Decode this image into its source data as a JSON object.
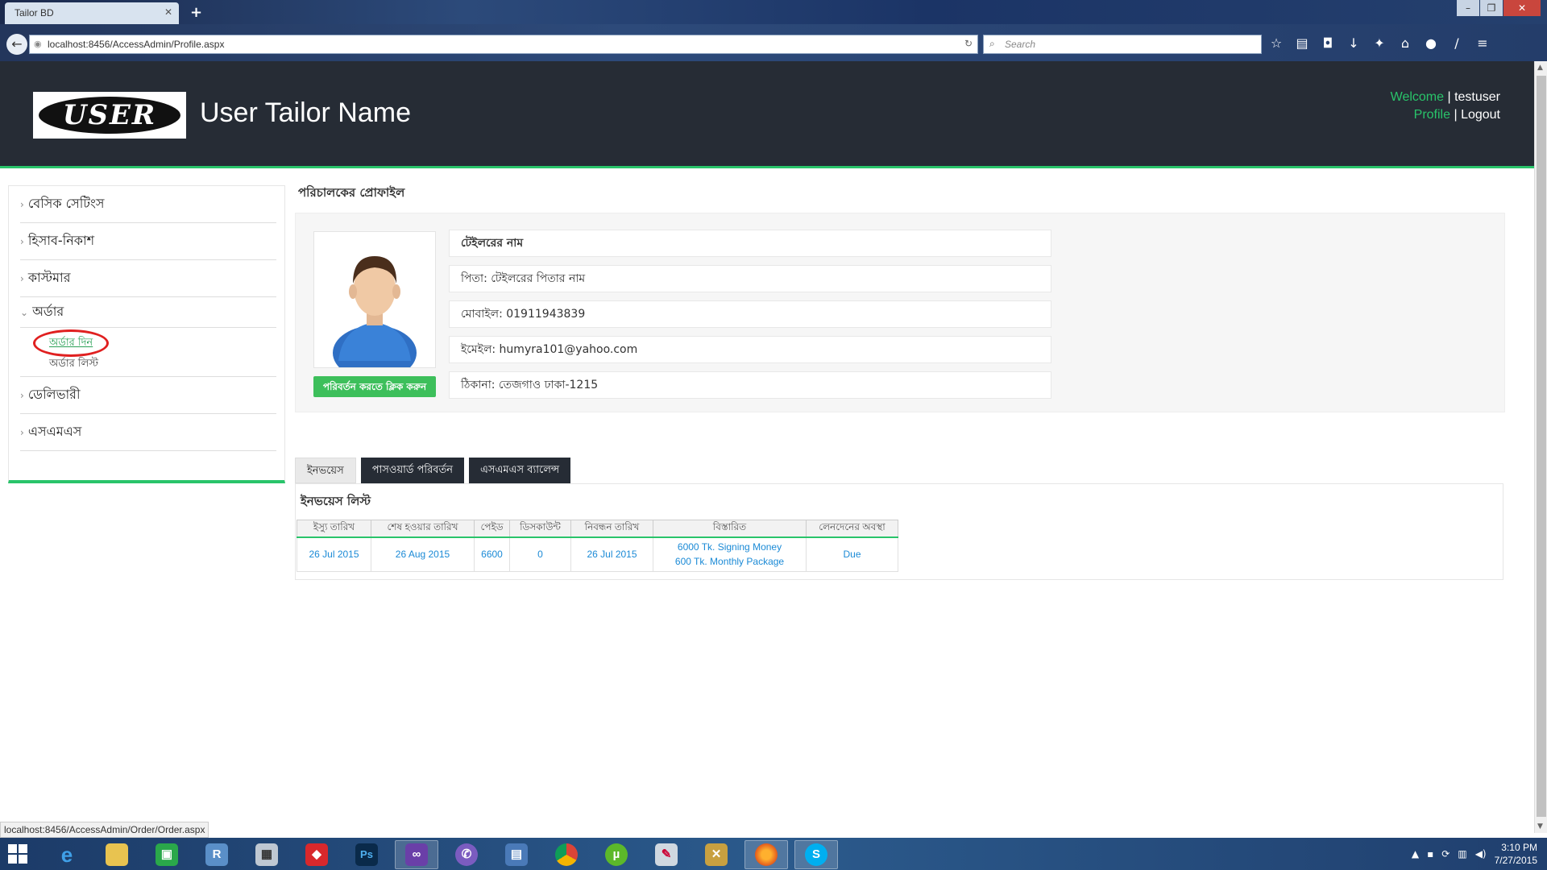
{
  "browser": {
    "tab_title": "Tailor BD",
    "url": "localhost:8456/AccessAdmin/Profile.aspx",
    "search_placeholder": "Search",
    "status_url": "localhost:8456/AccessAdmin/Order/Order.aspx"
  },
  "header": {
    "logo_text": "USER",
    "site_title": "User Tailor Name",
    "welcome_label": "Welcome",
    "username": "testuser",
    "profile_link": "Profile",
    "logout_link": "Logout"
  },
  "sidebar": {
    "items": [
      {
        "label": "বেসিক সেটিংস"
      },
      {
        "label": "হিসাব-নিকাশ"
      },
      {
        "label": "কাস্টমার"
      },
      {
        "label": "অর্ডার"
      },
      {
        "label": "ডেলিভারী"
      },
      {
        "label": "এসএমএস"
      }
    ],
    "order_sub": [
      {
        "label": "অর্ডার দিন"
      },
      {
        "label": "অর্ডার লিস্ট"
      }
    ]
  },
  "profile": {
    "heading": "পরিচালকের প্রোফাইল",
    "name": "টেইলরের নাম",
    "father": "পিতা: টেইলরের পিতার নাম",
    "mobile": "মোবাইল: 01911943839",
    "email": "ইমেইল: humyra101@yahoo.com",
    "address": "ঠিকানা: তেজগাও ঢাকা-1215",
    "change_button": "পরিবর্তন করতে ক্লিক করুন"
  },
  "tabs": [
    {
      "label": "ইনভয়েস"
    },
    {
      "label": "পাসওয়ার্ড পরিবর্তন"
    },
    {
      "label": "এসএমএস ব্যালেন্স"
    }
  ],
  "invoice": {
    "title": "ইনভয়েস লিস্ট",
    "columns": [
      "ইস্যু তারিখ",
      "শেষ হওয়ার তারিখ",
      "পেইড",
      "ডিসকাউন্ট",
      "নিবন্ধন তারিখ",
      "বিস্তারিত",
      "লেনদেনের অবস্থা"
    ],
    "rows": [
      {
        "issue_date": "26 Jul 2015",
        "end_date": "26 Aug 2015",
        "paid": "6600",
        "discount": "0",
        "reg_date": "26 Jul 2015",
        "detail_1": "6000 Tk. Signing Money",
        "detail_2": "600 Tk. Monthly Package",
        "status": "Due"
      }
    ]
  },
  "taskbar": {
    "time": "3:10 PM",
    "date": "7/27/2015"
  },
  "colors": {
    "accent_green": "#29c46a",
    "header_bg": "#262c35",
    "link_blue": "#1b8ad6",
    "highlight_red": "#e02020"
  }
}
